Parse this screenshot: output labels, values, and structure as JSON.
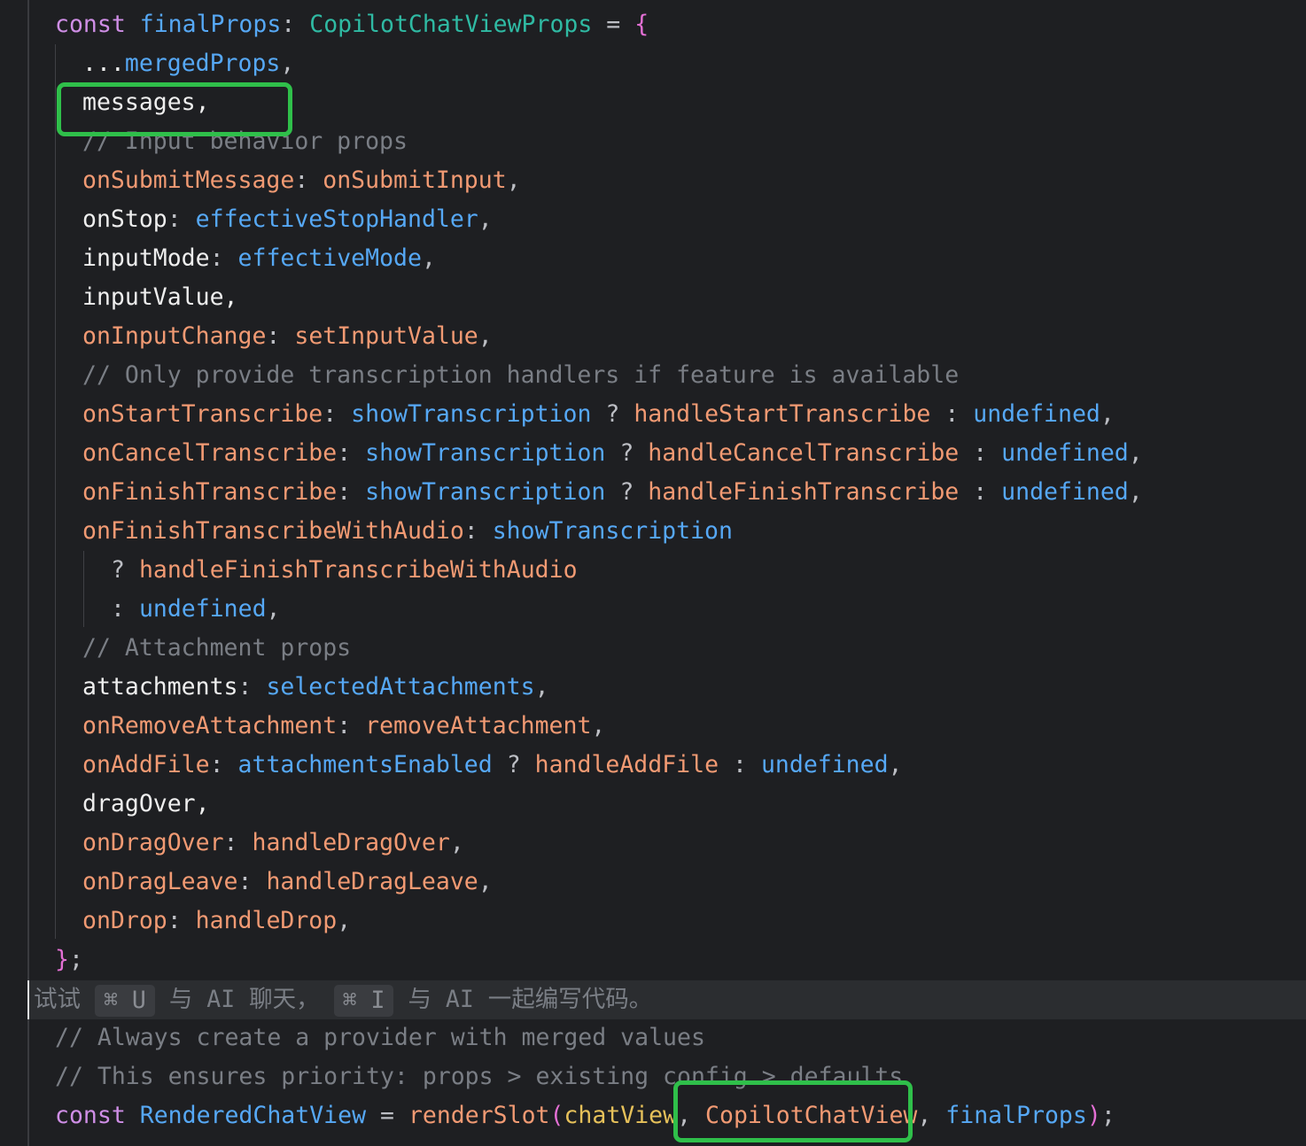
{
  "code": {
    "l1": {
      "kw": "const",
      "name": "finalProps",
      "colon": ":",
      "type": "CopilotChatViewProps",
      "eq": "=",
      "brace": "{"
    },
    "l2": {
      "spread": "...",
      "ref": "mergedProps",
      "comma": ","
    },
    "l3": {
      "text": "messages,"
    },
    "l4": {
      "comment": "// Input behavior props"
    },
    "l5": {
      "key": "onSubmitMessage",
      "colon": ":",
      "val": "onSubmitInput",
      "comma": ","
    },
    "l6": {
      "key": "onStop",
      "colon": ":",
      "val": "effectiveStopHandler",
      "comma": ","
    },
    "l7": {
      "key": "inputMode",
      "colon": ":",
      "val": "effectiveMode",
      "comma": ","
    },
    "l8": {
      "text": "inputValue,"
    },
    "l9": {
      "key": "onInputChange",
      "colon": ":",
      "val": "setInputValue",
      "comma": ","
    },
    "l10": {
      "comment": "// Only provide transcription handlers if feature is available"
    },
    "l11": {
      "key": "onStartTranscribe",
      "colon": ":",
      "cond": "showTranscription",
      "q": "?",
      "a": "handleStartTranscribe",
      "c": ":",
      "b": "undefined",
      "comma": ","
    },
    "l12": {
      "key": "onCancelTranscribe",
      "colon": ":",
      "cond": "showTranscription",
      "q": "?",
      "a": "handleCancelTranscribe",
      "c": ":",
      "b": "undefined",
      "comma": ","
    },
    "l13": {
      "key": "onFinishTranscribe",
      "colon": ":",
      "cond": "showTranscription",
      "q": "?",
      "a": "handleFinishTranscribe",
      "c": ":",
      "b": "undefined",
      "comma": ","
    },
    "l14": {
      "key": "onFinishTranscribeWithAudio",
      "colon": ":",
      "cond": "showTranscription"
    },
    "l15": {
      "q": "?",
      "a": "handleFinishTranscribeWithAudio"
    },
    "l16": {
      "c": ":",
      "b": "undefined",
      "comma": ","
    },
    "l17": {
      "comment": "// Attachment props"
    },
    "l18": {
      "key": "attachments",
      "colon": ":",
      "val": "selectedAttachments",
      "comma": ","
    },
    "l19": {
      "key": "onRemoveAttachment",
      "colon": ":",
      "val": "removeAttachment",
      "comma": ","
    },
    "l20": {
      "key": "onAddFile",
      "colon": ":",
      "cond": "attachmentsEnabled",
      "q": "?",
      "a": "handleAddFile",
      "c": ":",
      "b": "undefined",
      "comma": ","
    },
    "l21": {
      "text": "dragOver,"
    },
    "l22": {
      "key": "onDragOver",
      "colon": ":",
      "val": "handleDragOver",
      "comma": ","
    },
    "l23": {
      "key": "onDragLeave",
      "colon": ":",
      "val": "handleDragLeave",
      "comma": ","
    },
    "l24": {
      "key": "onDrop",
      "colon": ":",
      "val": "handleDrop",
      "comma": ","
    },
    "l25": {
      "brace": "}",
      "semi": ";"
    },
    "l27": {
      "comment": "// Always create a provider with merged values"
    },
    "l28": {
      "comment": "// This ensures priority: props > existing config > defaults"
    },
    "l29": {
      "kw": "const",
      "name": "RenderedChatView",
      "eq": "=",
      "fn": "renderSlot",
      "open": "(",
      "arg1": "chatView",
      "comma1": ",",
      "arg2": "CopilotChatView",
      "comma2": ",",
      "arg3": "finalProps",
      "close": ")",
      "semi": ";"
    }
  },
  "hint": {
    "try": "试试",
    "key1": "⌘ U",
    "text1": "与 AI 聊天，",
    "key2": "⌘ I",
    "text2": "与 AI 一起编写代码。"
  },
  "colors": {
    "highlight_box": "#2fbf4a",
    "background": "#1e1f22"
  }
}
